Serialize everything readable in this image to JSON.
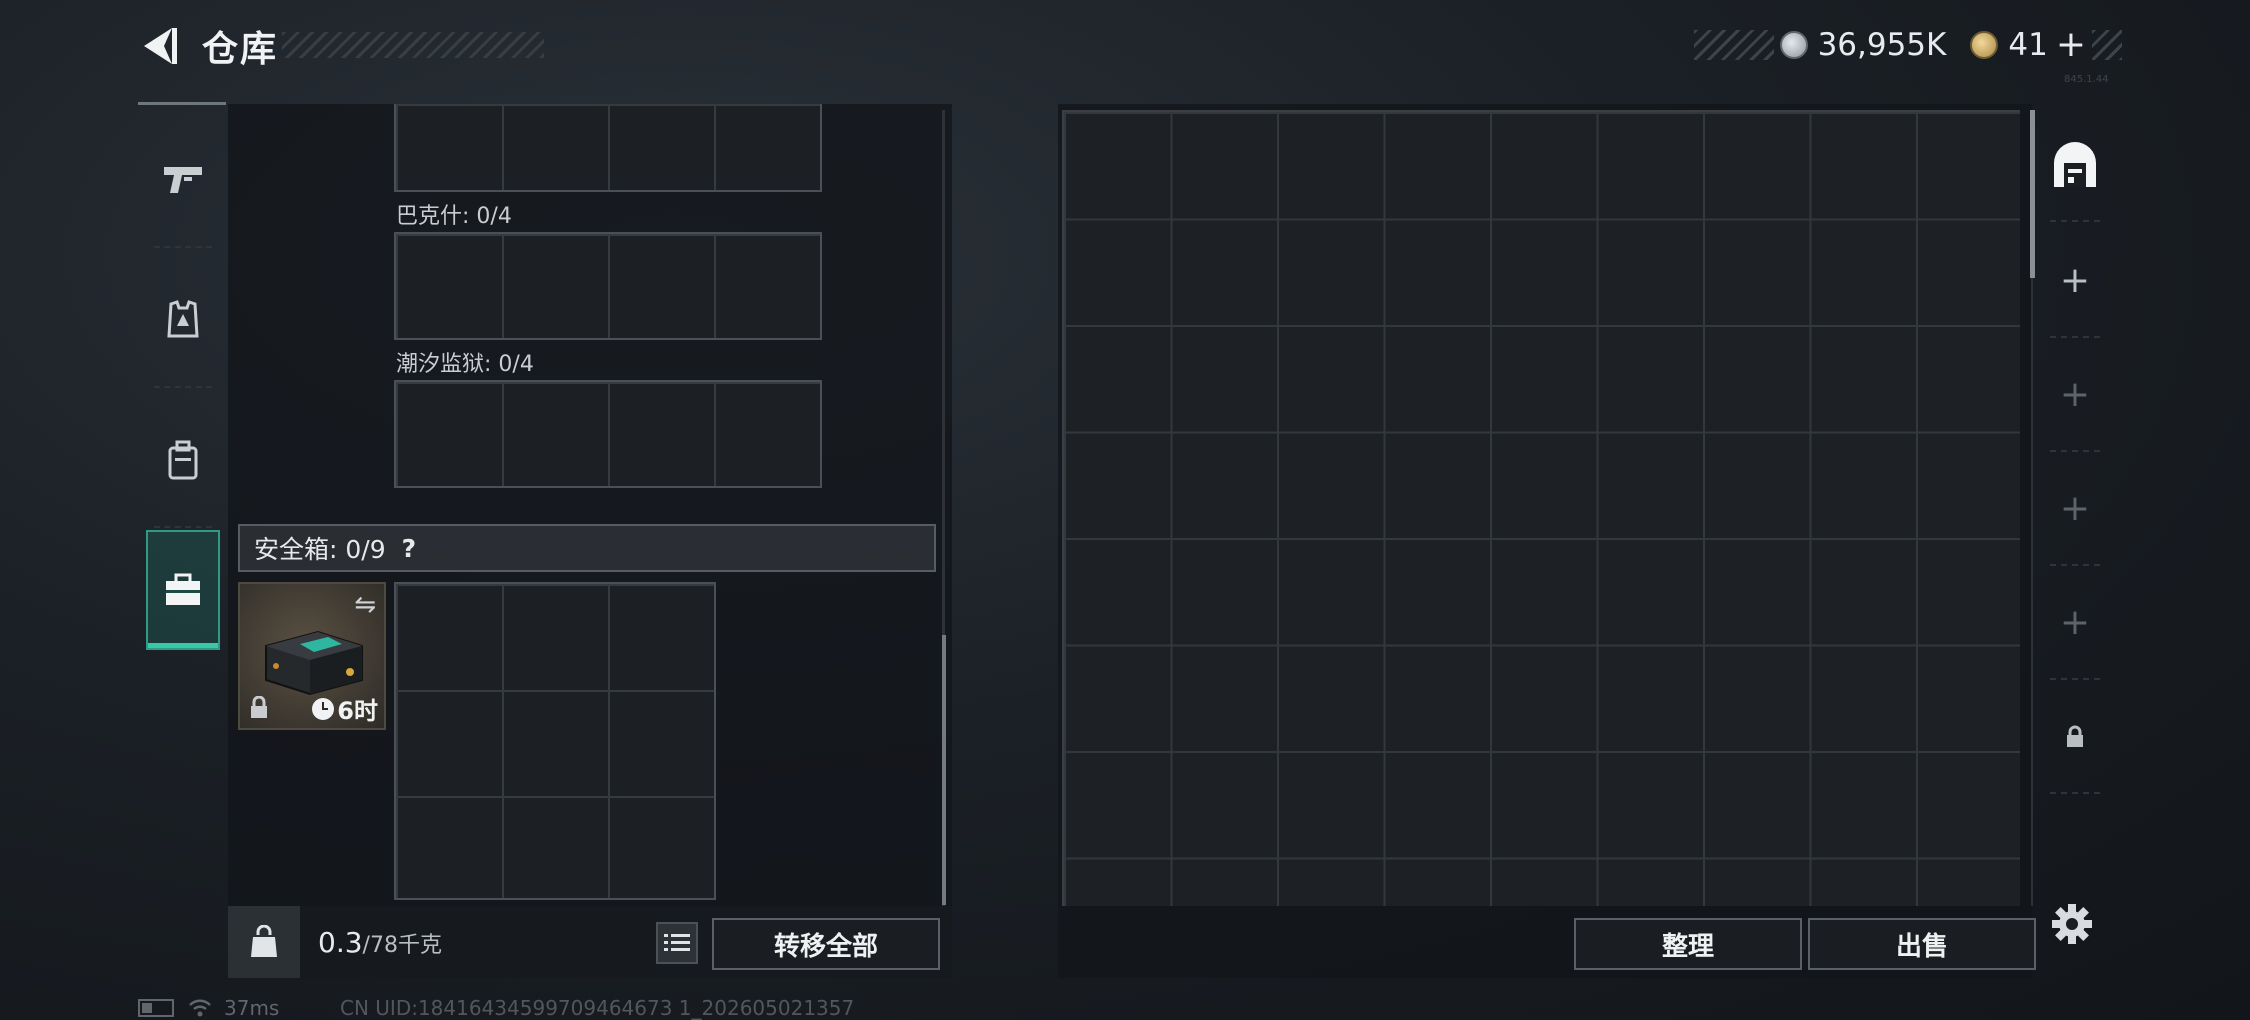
{
  "header": {
    "title": "仓库",
    "currency_silver": "36,955K",
    "currency_gold": "41",
    "plus_label": "+",
    "version": "845.1.44"
  },
  "category_tabs": [
    {
      "icon": "pistol-icon"
    },
    {
      "icon": "armor-vest-icon"
    },
    {
      "icon": "backpack-icon"
    },
    {
      "icon": "toolbox-icon",
      "active": true
    }
  ],
  "inventory": {
    "sections": [
      {
        "label": "巴克什: 0/4"
      },
      {
        "label": "潮汐监狱: 0/4"
      }
    ],
    "safe_box": {
      "label": "安全箱: 0/9",
      "help": "?",
      "timer": "6时",
      "swap_symbol": "⇋"
    },
    "weight_value": "0.3",
    "weight_unit": "/78千克",
    "transfer_all": "转移全部"
  },
  "stash": {
    "organize": "整理",
    "sell": "出售"
  },
  "side_tabs": [
    {
      "icon": "stash-icon"
    },
    {
      "icon": "plus-icon",
      "symbol": "+"
    },
    {
      "icon": "plus-icon",
      "symbol": "+"
    },
    {
      "icon": "plus-icon",
      "symbol": "+"
    },
    {
      "icon": "plus-icon",
      "symbol": "+"
    },
    {
      "icon": "lock-icon"
    }
  ],
  "status": {
    "ping": "37ms",
    "uid": "CN UID:18416434599709464673 1_202605021357"
  },
  "colors": {
    "accent": "#38c9a6",
    "panel": "#1c1f23"
  }
}
